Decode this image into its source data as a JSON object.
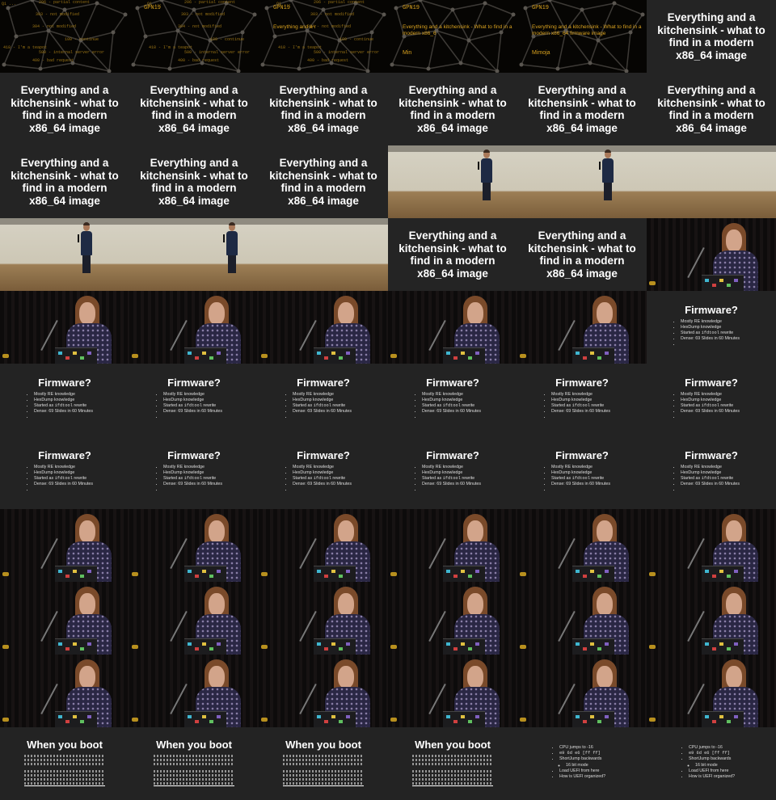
{
  "contact_sheet": {
    "columns": 6,
    "rows": 11,
    "intro_frames": [
      {
        "event": "GPN19",
        "title": "",
        "speaker": ""
      },
      {
        "event": "GPN19",
        "title": "",
        "speaker": ""
      },
      {
        "event": "GPN19",
        "title": "Everything and a r",
        "speaker": ""
      },
      {
        "event": "GPN19",
        "title": "Everything and a kitchensink - What to find in a modern x86_6",
        "speaker": "Min"
      },
      {
        "event": "GPN19",
        "title": "Everything and a kitchensink - What to find in a modern x86_64 firmware image",
        "speaker": "Mimoja"
      }
    ],
    "intro_code_snippets": [
      "Q1 ...",
      "206 - partial content",
      "303 - not modified",
      "304 - not modified",
      "100 - continue",
      "418 - I'm a teapot",
      "500 - internal server error",
      "400 - bad request"
    ],
    "title_slide": {
      "text": "Everything and a kitchensink - what to find in a modern x86_64 image"
    },
    "firmware_slide": {
      "heading": "Firmware?",
      "bullets": [
        "Mostly RE knowledge",
        "HexDump knowledge",
        "Started as ifdtool rewrite",
        "Dense: 69 Slides in 60 Minutes",
        ""
      ],
      "bullet_code_word": "ifdtool"
    },
    "boot_slide": {
      "heading": "When you boot"
    },
    "cpu_slide": {
      "bullets": [
        {
          "text": "CPU jumps to -16",
          "sub": false
        },
        {
          "text": "e9 6d e6 [ff ff]",
          "sub": false,
          "code": true
        },
        {
          "text": "ShortJump backwards",
          "sub": false
        },
        {
          "text": "16 bit mode",
          "sub": true
        },
        {
          "text": "Load UEFI from here",
          "sub": false
        },
        {
          "text": "How is UEFI organized?",
          "sub": false
        }
      ]
    },
    "frames": [
      "intro",
      "intro",
      "intro",
      "intro",
      "intro",
      "title",
      "title",
      "title",
      "title",
      "title",
      "title",
      "title",
      "title",
      "title",
      "title",
      "stage",
      "stage",
      "stage",
      "stage",
      "stage",
      "stage",
      "title",
      "title",
      "close",
      "close",
      "close",
      "close",
      "close",
      "close",
      "firmware",
      "firmware",
      "firmware",
      "firmware",
      "firmware",
      "firmware",
      "firmware",
      "firmware",
      "firmware",
      "firmware",
      "firmware",
      "firmware",
      "firmware",
      "close",
      "close",
      "close",
      "close",
      "close",
      "close",
      "close",
      "close",
      "close",
      "close",
      "close",
      "close",
      "close",
      "close",
      "close",
      "close",
      "close",
      "close",
      "boot",
      "boot",
      "boot",
      "boot",
      "cpu",
      "cpu"
    ],
    "colors": {
      "intro_accent": "#d9a21f",
      "slide_bg": "#242424",
      "slide_text": "#ffffff"
    }
  }
}
